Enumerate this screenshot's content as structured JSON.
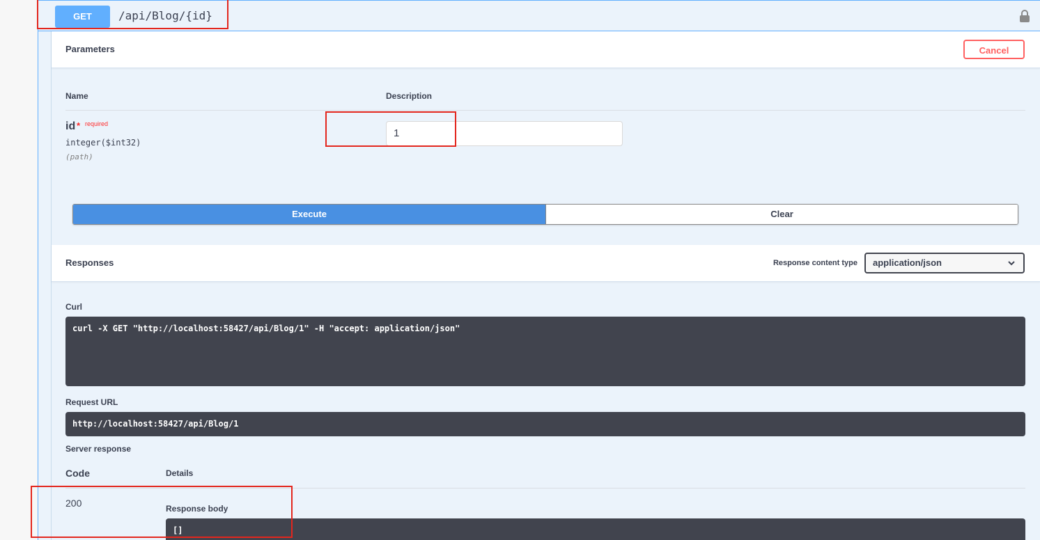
{
  "summary": {
    "method": "GET",
    "path": "/api/Blog/{id}",
    "lock_icon": "lock-icon"
  },
  "parameters": {
    "title": "Parameters",
    "cancel_label": "Cancel",
    "col_name": "Name",
    "col_description": "Description",
    "param": {
      "name": "id",
      "star": "*",
      "required": "required",
      "type": "integer($int32)",
      "in": "(path)",
      "value": "1"
    },
    "execute_label": "Execute",
    "clear_label": "Clear"
  },
  "responses": {
    "title": "Responses",
    "content_type_label": "Response content type",
    "content_type_value": "application/json",
    "curl_label": "Curl",
    "curl_value": "curl -X GET \"http://localhost:58427/api/Blog/1\" -H \"accept: application/json\"",
    "request_url_label": "Request URL",
    "request_url_value": "http://localhost:58427/api/Blog/1",
    "server_response_label": "Server response",
    "col_code": "Code",
    "col_details": "Details",
    "row": {
      "code": "200",
      "body_label": "Response body",
      "body": "[]"
    }
  },
  "colors": {
    "get": "#61affe",
    "execute": "#4990e2",
    "cancel": "#ff6060",
    "highlight": "#e3261d"
  }
}
